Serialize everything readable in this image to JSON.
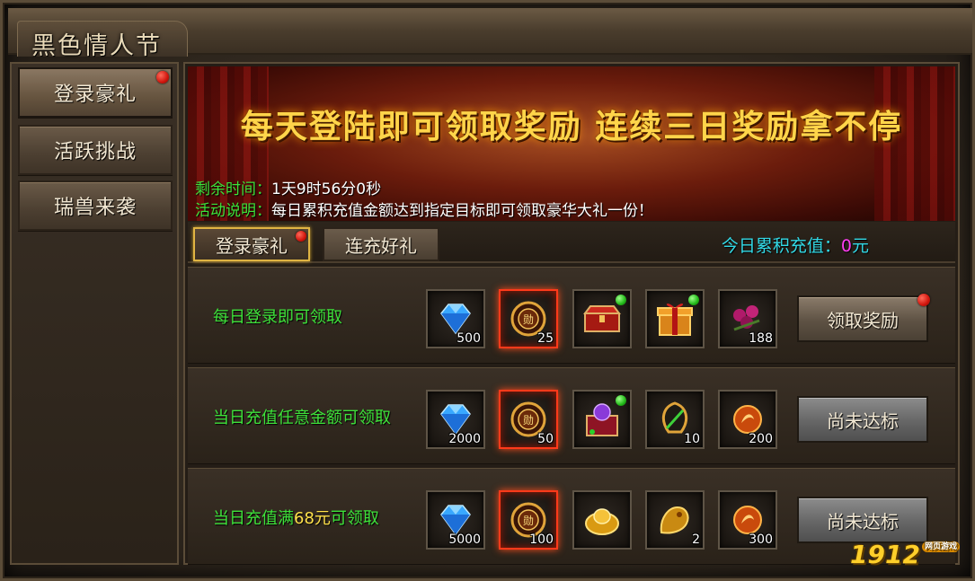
{
  "window": {
    "title": "黑色情人节"
  },
  "sidebar": {
    "items": [
      {
        "label": "登录豪礼",
        "active": true,
        "badge": true
      },
      {
        "label": "活跃挑战",
        "active": false,
        "badge": false
      },
      {
        "label": "瑞兽来袭",
        "active": false,
        "badge": false
      }
    ]
  },
  "banner": {
    "headline": "每天登陆即可领取奖励 连续三日奖励拿不停",
    "remaining_label": "剩余时间：",
    "remaining_value": "1天9时56分0秒",
    "desc_label": "活动说明：",
    "desc_value": "每日累积充值金额达到指定目标即可领取豪华大礼一份！"
  },
  "tabs": [
    {
      "label": "登录豪礼",
      "active": true,
      "badge": true
    },
    {
      "label": "连充好礼",
      "active": false,
      "badge": false
    }
  ],
  "today": {
    "label": "今日累积充值：",
    "amount": "0",
    "unit": "元"
  },
  "rows": [
    {
      "label": "每日登录即可领取",
      "items": [
        {
          "icon": "diamond-icon",
          "qty": "500"
        },
        {
          "icon": "medal-coin-icon",
          "qty": "25",
          "glow": true
        },
        {
          "icon": "treasure-chest-icon",
          "qty": "",
          "new": true
        },
        {
          "icon": "gift-box-icon",
          "qty": "",
          "new": true
        },
        {
          "icon": "flower-icon",
          "qty": "188"
        }
      ],
      "button": "领取奖励",
      "button_state": "ready"
    },
    {
      "label": "当日充值任意金额可领取",
      "items": [
        {
          "icon": "diamond-icon",
          "qty": "2000"
        },
        {
          "icon": "medal-coin-icon",
          "qty": "50",
          "glow": true
        },
        {
          "icon": "gem-chest-icon",
          "qty": "",
          "new": true
        },
        {
          "icon": "amulet-icon",
          "qty": "10"
        },
        {
          "icon": "fire-orb-icon",
          "qty": "200"
        }
      ],
      "button": "尚未达标",
      "button_state": "disabled"
    },
    {
      "label_pre": "当日充值满",
      "label_hl": "68元",
      "label_post": "可领取",
      "items": [
        {
          "icon": "diamond-icon",
          "qty": "5000"
        },
        {
          "icon": "medal-coin-icon",
          "qty": "100",
          "glow": true
        },
        {
          "icon": "gold-ingot-icon",
          "qty": ""
        },
        {
          "icon": "golden-beast-icon",
          "qty": "2"
        },
        {
          "icon": "fire-orb-icon",
          "qty": "300"
        }
      ],
      "button": "尚未达标",
      "button_state": "disabled"
    }
  ],
  "watermark": {
    "brand": "1912",
    "sub": "网页游戏"
  }
}
